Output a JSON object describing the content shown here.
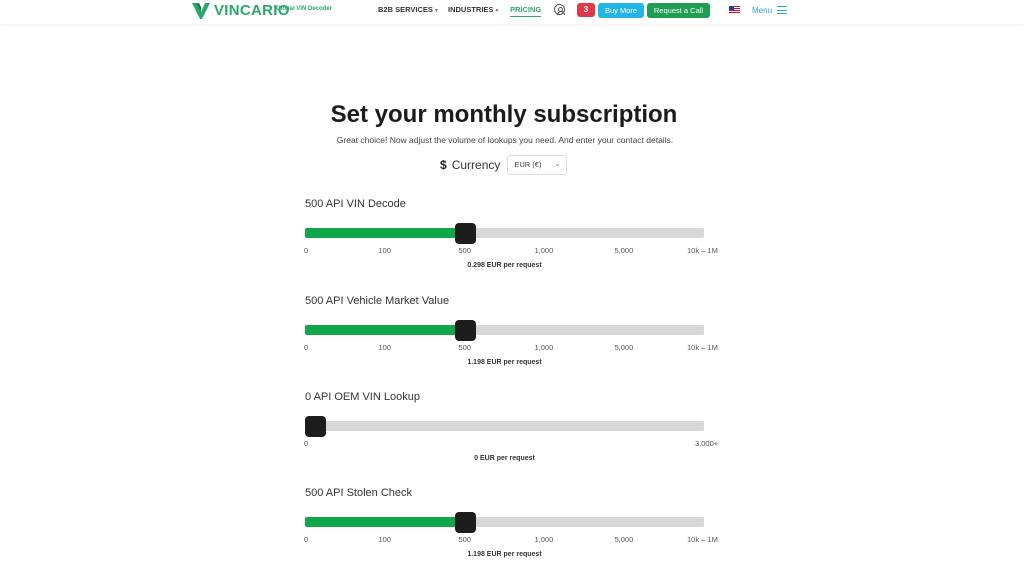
{
  "header": {
    "logo_text": "VINCARIO",
    "logo_sub": "Global VIN Decoder",
    "nav": [
      {
        "label": "B2B SERVICES",
        "caret": "▾"
      },
      {
        "label": "INDUSTRIES",
        "caret": "▾"
      },
      {
        "label": "PRICING"
      }
    ],
    "cart_count": "3",
    "buy_more": "Buy More",
    "request_call": "Request a Call",
    "menu": "Menu",
    "colors": {
      "brand": "#2aa86b",
      "buy": "#21b6e6",
      "call": "#1f9d55",
      "badge": "#e03a4a"
    }
  },
  "main": {
    "title": "Set your monthly subscription",
    "subtitle": "Great choice! Now adjust the volume of lookups you need. And enter your contact details.",
    "currency_symbol": "$",
    "currency_label": "Currency",
    "currency_value": "EUR (€)",
    "currency_chevron": "⌄"
  },
  "sliders": [
    {
      "title": "500 API VIN Decode",
      "ticks": [
        "0",
        "100",
        "500",
        "1,000",
        "5,000",
        "10k – 1M"
      ],
      "selected_index": 2,
      "price": "0.298 EUR per request"
    },
    {
      "title": "500 API Vehicle Market Value",
      "ticks": [
        "0",
        "100",
        "500",
        "1,000",
        "5,000",
        "10k – 1M"
      ],
      "selected_index": 2,
      "price": "1.198 EUR per request"
    },
    {
      "title": "0 API OEM VIN Lookup",
      "ticks": [
        "0",
        "3,000+"
      ],
      "selected_index": 0,
      "price": "0 EUR per request"
    },
    {
      "title": "500 API Stolen Check",
      "ticks": [
        "0",
        "100",
        "500",
        "1,000",
        "5,000",
        "10k – 1M"
      ],
      "selected_index": 2,
      "price": "1.198 EUR per request"
    }
  ],
  "colors": {
    "fill": "#10a64a",
    "track": "#d7d7d7",
    "thumb": "#1d1d1d"
  }
}
